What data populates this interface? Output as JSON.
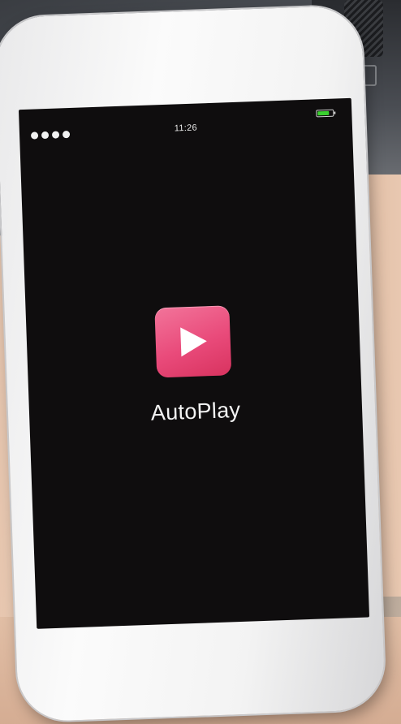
{
  "status_bar": {
    "time": "11:26",
    "signal_dots": 4,
    "battery_level": 0.78,
    "battery_color": "#3ad12f"
  },
  "app": {
    "name": "AutoPlay",
    "icon": "play-icon",
    "icon_color": "#e94a7a"
  }
}
